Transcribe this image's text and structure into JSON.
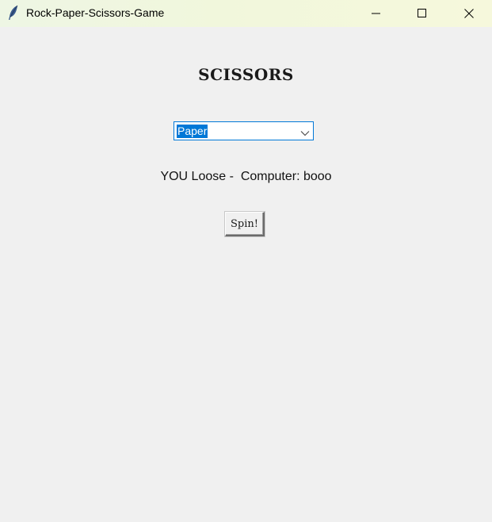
{
  "window": {
    "title": "Rock-Paper-Scissors-Game",
    "icon": "feather-icon",
    "controls": [
      "minimize-icon",
      "maximize-icon",
      "close-icon"
    ]
  },
  "game": {
    "player_choice_heading": "SCISSORS",
    "choice_select": {
      "selected_value": "Paper",
      "icon": "chevron-down-icon"
    },
    "result_text": "YOU Loose -  Computer: booo",
    "spin_button_label": "Spin!"
  },
  "colors": {
    "selection_highlight": "#0078d7",
    "background": "#f0f0f0"
  }
}
